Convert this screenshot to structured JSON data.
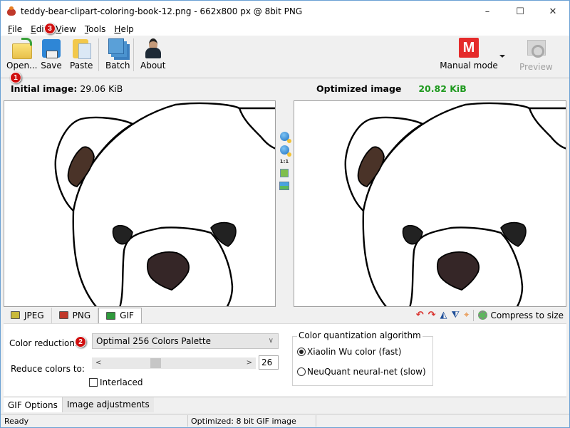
{
  "window": {
    "title": "teddy-bear-clipart-coloring-book-12.png - 662x800 px @ 8bit PNG",
    "minimize": "–",
    "maximize": "☐",
    "close": "✕"
  },
  "menu": [
    {
      "label": "File",
      "accel": "F",
      "rest": "ile"
    },
    {
      "label": "Edit",
      "accel": "E",
      "rest": "dit"
    },
    {
      "label": "View",
      "accel": "V",
      "rest": "iew"
    },
    {
      "label": "Tools",
      "accel": "T",
      "rest": "ools"
    },
    {
      "label": "Help",
      "accel": "H",
      "rest": "elp"
    }
  ],
  "toolbar": {
    "open": "Open...",
    "save": "Save",
    "paste": "Paste",
    "batch": "Batch",
    "about": "About",
    "mode_badge": "M",
    "mode": "Manual mode",
    "preview": "Preview"
  },
  "images": {
    "initial_label": "Initial image:",
    "initial_size": "29.06 KiB",
    "optimized_label": "Optimized image",
    "optimized_size": "20.82 KiB",
    "one_to_one": "1:1"
  },
  "format_tabs": [
    {
      "label": "JPEG",
      "active": false
    },
    {
      "label": "PNG",
      "active": false
    },
    {
      "label": "GIF",
      "active": true
    }
  ],
  "right_tools": {
    "compress": "Compress to size",
    "rotate_left": "↶",
    "rotate_right": "↷",
    "flip_h": "◭",
    "flip_v": "⧨",
    "crop": "⌖"
  },
  "gif_options": {
    "color_reduction_label": "Color reduction:",
    "color_reduction_value": "Optimal 256 Colors Palette",
    "reduce_colors_label": "Reduce colors to:",
    "reduce_colors_value": "26",
    "slider_fraction": 0.36,
    "interlaced_label": "Interlaced",
    "interlaced_checked": false,
    "quant_group_label": "Color quantization algorithm",
    "quant_options": [
      {
        "label": "Xiaolin Wu color (fast)",
        "selected": true
      },
      {
        "label": "NeuQuant neural-net (slow)",
        "selected": false
      }
    ]
  },
  "bottom_tabs": [
    {
      "label": "GIF Options",
      "active": true
    },
    {
      "label": "Image adjustments",
      "active": false
    }
  ],
  "status": {
    "left": "Ready",
    "middle": "Optimized: 8 bit GIF image"
  },
  "annotations": [
    "1",
    "2",
    "3"
  ],
  "colors": {
    "accent_red": "#e52b2b",
    "size_green": "#1f9a1f",
    "badge_red": "#d00f0f"
  }
}
